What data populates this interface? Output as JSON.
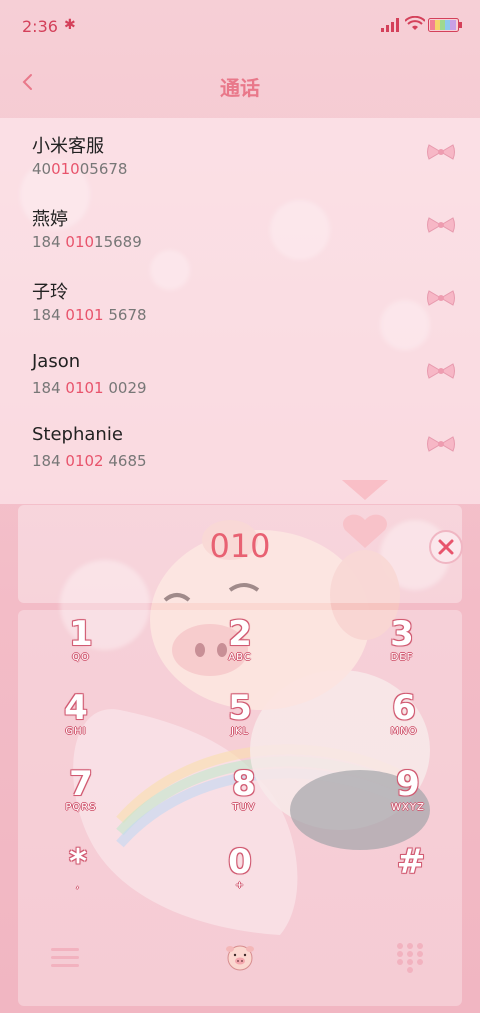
{
  "status_bar": {
    "time": "2:36"
  },
  "header": {
    "title": "通话"
  },
  "contacts": [
    {
      "name": "小米客服",
      "number_pre": "40",
      "number_hl": "010",
      "number_post": "05678"
    },
    {
      "name": "燕婷",
      "number_pre": "184 ",
      "number_hl": "010",
      "number_post": "15689"
    },
    {
      "name": "子玲",
      "number_pre": "184 ",
      "number_hl": "0101",
      "number_post": " 5678"
    },
    {
      "name": "Jason",
      "number_pre": "184 ",
      "number_hl": "0101",
      "number_post": " 0029"
    },
    {
      "name": "Stephanie",
      "number_pre": "184 ",
      "number_hl": "0102",
      "number_post": " 4685"
    }
  ],
  "dial_input": {
    "value": "010"
  },
  "keypad": [
    {
      "digit": "1",
      "letters": "QO"
    },
    {
      "digit": "2",
      "letters": "ABC"
    },
    {
      "digit": "3",
      "letters": "DEF"
    },
    {
      "digit": "4",
      "letters": "GHI"
    },
    {
      "digit": "5",
      "letters": "JKL"
    },
    {
      "digit": "6",
      "letters": "MNO"
    },
    {
      "digit": "7",
      "letters": "PQRS"
    },
    {
      "digit": "8",
      "letters": "TUV"
    },
    {
      "digit": "9",
      "letters": "WXYZ"
    },
    {
      "digit": "*",
      "letters": ","
    },
    {
      "digit": "0",
      "letters": "+"
    },
    {
      "digit": "#",
      "letters": ""
    }
  ],
  "colors": {
    "accent": "#e8546c",
    "title": "#e9788a",
    "background": "#f4c4cd"
  },
  "icons": {
    "back": "chevron-left-icon",
    "delete": "delete-icon",
    "menu": "menu-icon",
    "pig": "pig-icon",
    "keypad": "keypad-grid-icon",
    "contact_action": "bow-icon"
  }
}
